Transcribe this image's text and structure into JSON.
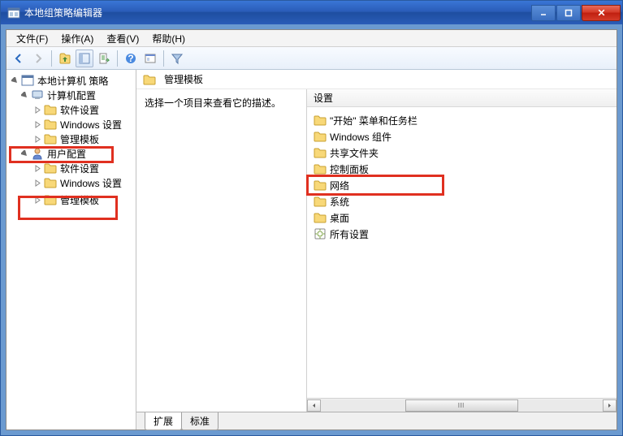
{
  "window": {
    "title": "本地组策略编辑器"
  },
  "menu": {
    "file": "文件(F)",
    "action": "操作(A)",
    "view": "查看(V)",
    "help": "帮助(H)"
  },
  "tree": {
    "root": "本地计算机 策略",
    "computer_config": "计算机配置",
    "cc_software": "软件设置",
    "cc_windows": "Windows 设置",
    "cc_admin": "管理模板",
    "user_config": "用户配置",
    "uc_software": "软件设置",
    "uc_windows": "Windows 设置",
    "uc_admin": "管理模板"
  },
  "breadcrumb": {
    "title": "管理模板"
  },
  "description": {
    "prompt": "选择一个项目来查看它的描述。"
  },
  "list_header": {
    "col": "设置"
  },
  "list": {
    "items": [
      "\"开始\" 菜单和任务栏",
      "Windows 组件",
      "共享文件夹",
      "控制面板",
      "网络",
      "系统",
      "桌面",
      "所有设置"
    ]
  },
  "tabs": {
    "extended": "扩展",
    "standard": "标准"
  }
}
